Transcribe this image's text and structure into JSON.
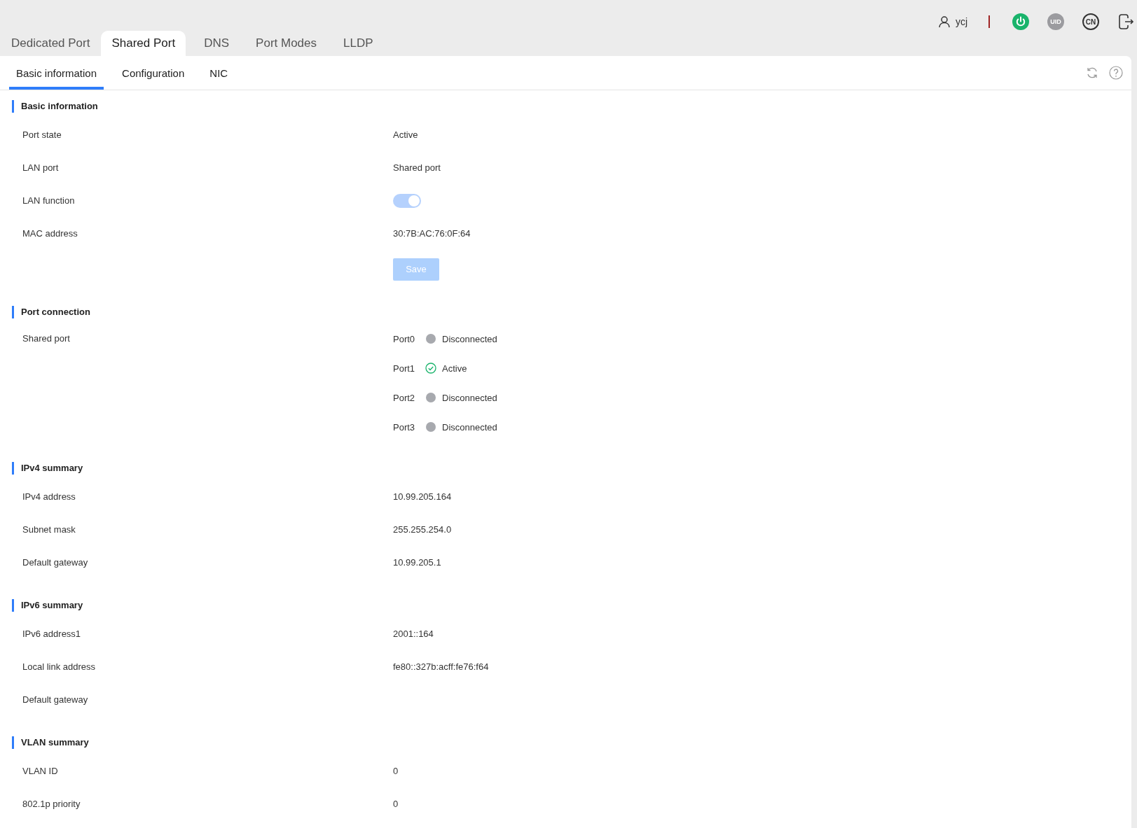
{
  "header": {
    "user": "ycj",
    "power_on": true,
    "uid_label": "UID",
    "language": "CN"
  },
  "tabs": [
    {
      "label": "Dedicated Port",
      "selected": false
    },
    {
      "label": "Shared Port",
      "selected": true
    },
    {
      "label": "DNS",
      "selected": false
    },
    {
      "label": "Port Modes",
      "selected": false
    },
    {
      "label": "LLDP",
      "selected": false
    }
  ],
  "subtabs": [
    {
      "label": "Basic information",
      "selected": true
    },
    {
      "label": "Configuration",
      "selected": false
    },
    {
      "label": "NIC",
      "selected": false
    }
  ],
  "sections": [
    {
      "title": "Basic information",
      "rows": [
        {
          "kind": "text",
          "label": "Port state",
          "value": "Active"
        },
        {
          "kind": "text",
          "label": "LAN port",
          "value": "Shared port"
        },
        {
          "kind": "toggle",
          "label": "LAN function",
          "on": true,
          "disabled": true
        },
        {
          "kind": "text",
          "label": "MAC address",
          "value": "30:7B:AC:76:0F:64"
        },
        {
          "kind": "button",
          "value": "Save",
          "disabled": true
        }
      ]
    },
    {
      "title": "Port connection",
      "rows": [
        {
          "kind": "ports",
          "label": "Shared port",
          "ports": [
            {
              "name": "Port0",
              "status": "Disconnected",
              "kind": "disconnected"
            },
            {
              "name": "Port1",
              "status": "Active",
              "kind": "active"
            },
            {
              "name": "Port2",
              "status": "Disconnected",
              "kind": "disconnected"
            },
            {
              "name": "Port3",
              "status": "Disconnected",
              "kind": "disconnected"
            }
          ]
        }
      ]
    },
    {
      "title": "IPv4 summary",
      "rows": [
        {
          "kind": "text",
          "label": "IPv4 address",
          "value": "10.99.205.164"
        },
        {
          "kind": "text",
          "label": "Subnet mask",
          "value": "255.255.254.0"
        },
        {
          "kind": "text",
          "label": "Default gateway",
          "value": "10.99.205.1"
        }
      ]
    },
    {
      "title": "IPv6 summary",
      "rows": [
        {
          "kind": "text",
          "label": "IPv6 address1",
          "value": "2001::164"
        },
        {
          "kind": "text",
          "label": "Local link address",
          "value": "fe80::327b:acff:fe76:f64"
        },
        {
          "kind": "text",
          "label": "Default gateway"
        }
      ]
    },
    {
      "title": "VLAN summary",
      "rows": [
        {
          "kind": "text",
          "label": "VLAN ID",
          "value": "0"
        },
        {
          "kind": "text",
          "label": "802.1p priority",
          "value": "0"
        }
      ]
    }
  ]
}
